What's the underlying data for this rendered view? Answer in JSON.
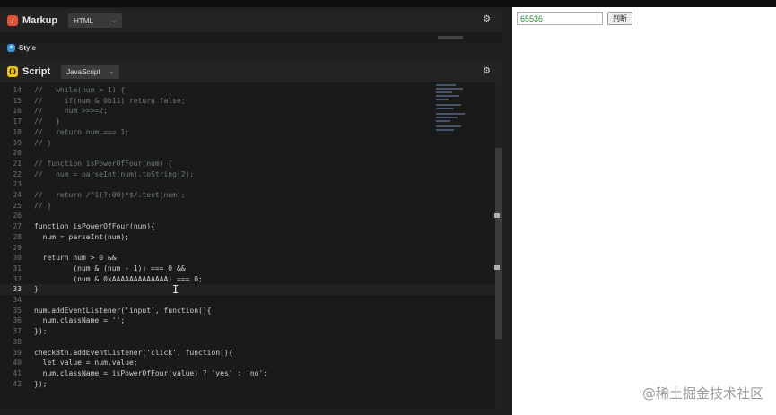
{
  "markup_panel": {
    "title": "Markup",
    "language": "HTML"
  },
  "style_panel": {
    "title": "Style"
  },
  "script_panel": {
    "title": "Script",
    "language": "JavaScript"
  },
  "code_lines": [
    {
      "n": "14",
      "text": "//   while(num > 1) {"
    },
    {
      "n": "15",
      "text": "//     if(num & 0b11) return false;"
    },
    {
      "n": "16",
      "text": "//     num >>>=2;"
    },
    {
      "n": "17",
      "text": "//   }"
    },
    {
      "n": "18",
      "text": "//   return num === 1;"
    },
    {
      "n": "19",
      "text": "// }"
    },
    {
      "n": "20",
      "text": ""
    },
    {
      "n": "21",
      "text": "// function isPowerOfFour(num) {"
    },
    {
      "n": "22",
      "text": "//   num = parseInt(num).toString(2);"
    },
    {
      "n": "23",
      "text": ""
    },
    {
      "n": "24",
      "text": "//   return /^1(?:00)*$/.test(num);"
    },
    {
      "n": "25",
      "text": "// }"
    },
    {
      "n": "26",
      "text": ""
    },
    {
      "n": "27",
      "text": "function isPowerOfFour(num){"
    },
    {
      "n": "28",
      "text": "  num = parseInt(num);"
    },
    {
      "n": "29",
      "text": ""
    },
    {
      "n": "30",
      "text": "  return num > 0 &&"
    },
    {
      "n": "31",
      "text": "         (num & (num - 1)) === 0 &&"
    },
    {
      "n": "32",
      "text": "         (num & 0xAAAAAAAAAAAAA) === 0;"
    },
    {
      "n": "33",
      "text": "}"
    },
    {
      "n": "34",
      "text": ""
    },
    {
      "n": "35",
      "text": "num.addEventListener('input', function(){"
    },
    {
      "n": "36",
      "text": "  num.className = '';"
    },
    {
      "n": "37",
      "text": "});"
    },
    {
      "n": "38",
      "text": ""
    },
    {
      "n": "39",
      "text": "checkBtn.addEventListener('click', function(){"
    },
    {
      "n": "40",
      "text": "  let value = num.value;"
    },
    {
      "n": "41",
      "text": "  num.className = isPowerOfFour(value) ? 'yes' : 'no';"
    },
    {
      "n": "42",
      "text": "});"
    }
  ],
  "active_line": "33",
  "preview": {
    "input_value": "65536",
    "button_label": "判断"
  },
  "watermark": "@稀土掘金技术社区",
  "colors": {
    "input_text": "#2e8b3e",
    "markup_badge": "#e0523a",
    "script_badge": "#f0c419",
    "style_badge": "#3b97d9"
  },
  "icons": {
    "settings": "gear-icon",
    "dropdown": "chevron-down-icon"
  }
}
